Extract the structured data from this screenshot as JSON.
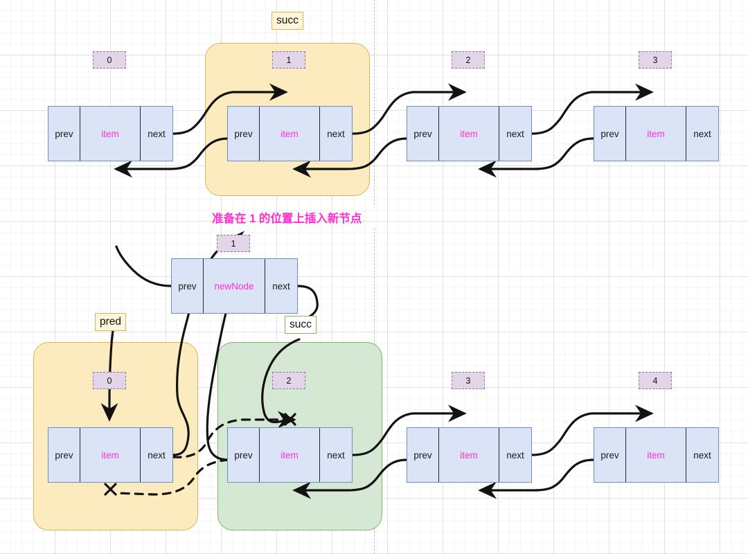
{
  "diagram": {
    "title_caption": "准备在 1 的位置上插入新节点",
    "colors": {
      "node_fill": "#dae4f6",
      "node_stroke": "#6c8ebf",
      "group_yellow_fill": "#fdebc0",
      "group_yellow_stroke": "#d6b656",
      "group_green_fill": "#d5e8d4",
      "group_green_stroke": "#82b366",
      "index_badge_fill": "#e1d5e7",
      "index_badge_stroke": "#9673a6",
      "accent_pink": "#ff2fd0",
      "edge_stroke": "#121212"
    },
    "cell_labels": {
      "prev": "prev",
      "next": "next",
      "item": "item",
      "new_item": "newNode"
    },
    "top_row": {
      "nodes": [
        {
          "index": "0",
          "item": "item",
          "prev": "prev",
          "next": "next",
          "highlighted": false
        },
        {
          "index": "1",
          "item": "item",
          "prev": "prev",
          "next": "next",
          "highlighted": true
        },
        {
          "index": "2",
          "item": "item",
          "prev": "prev",
          "next": "next",
          "highlighted": false
        },
        {
          "index": "3",
          "item": "item",
          "prev": "prev",
          "next": "next",
          "highlighted": false
        }
      ],
      "pointer_labels": [
        {
          "name": "succ",
          "style": "cream"
        }
      ]
    },
    "new_node": {
      "index": "1",
      "item": "newNode",
      "prev": "prev",
      "next": "next"
    },
    "bottom_row": {
      "nodes": [
        {
          "index": "0",
          "item": "item",
          "prev": "prev",
          "next": "next",
          "group": "yellow"
        },
        {
          "index": "2",
          "item": "item",
          "prev": "prev",
          "next": "next",
          "group": "green"
        },
        {
          "index": "3",
          "item": "item",
          "prev": "prev",
          "next": "next",
          "group": "none"
        },
        {
          "index": "4",
          "item": "item",
          "prev": "prev",
          "next": "next",
          "group": "none"
        }
      ],
      "pointer_labels": [
        {
          "name": "pred",
          "style": "cream"
        },
        {
          "name": "succ",
          "style": "greenb"
        }
      ]
    },
    "annotations": {
      "broken_link_marker": "✕"
    }
  }
}
